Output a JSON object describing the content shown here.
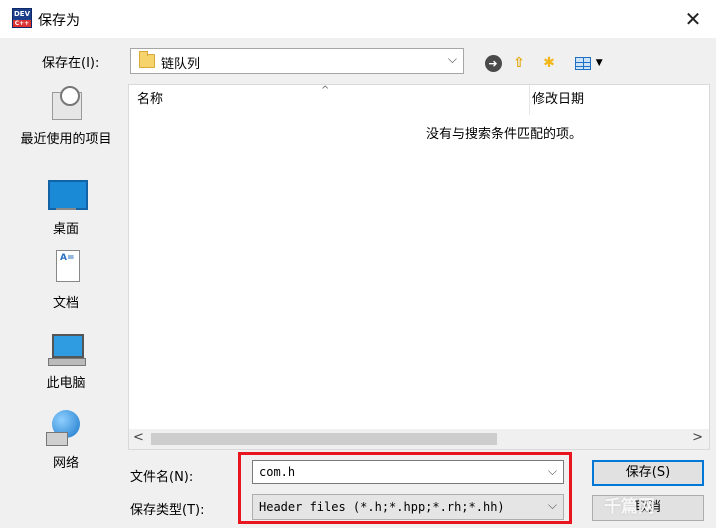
{
  "window": {
    "title": "保存为",
    "icon_label": "DEV",
    "icon_sub": "C++",
    "close_glyph": "✕"
  },
  "toolbar": {
    "savein_label": "保存在(I):",
    "savein_value": "链队列",
    "combo_arrow": "⌵",
    "back_glyph": "➜",
    "up_glyph": "⇧",
    "newfolder_glyph": "✱",
    "view_caret": "▼"
  },
  "places": [
    {
      "label": "最近使用的项目"
    },
    {
      "label": "桌面"
    },
    {
      "label": "文档"
    },
    {
      "label": "此电脑"
    },
    {
      "label": "网络"
    }
  ],
  "filelist": {
    "columns": {
      "name": "名称",
      "date": "修改日期"
    },
    "sort_caret": "^",
    "empty_message": "没有与搜索条件匹配的项。",
    "scroll_left": "<",
    "scroll_right": ">"
  },
  "form": {
    "filename_label": "文件名(N):",
    "filename_value": "com.h",
    "filetype_label": "保存类型(T):",
    "filetype_value": "Header files (*.h;*.hpp;*.rh;*.hh)",
    "dropdown_arrow": "⌵"
  },
  "buttons": {
    "save": "保存(S)",
    "cancel": "取消"
  },
  "watermark": "千篇网",
  "colors": {
    "highlight": "#e8141e",
    "default_button_border": "#0078d7"
  }
}
